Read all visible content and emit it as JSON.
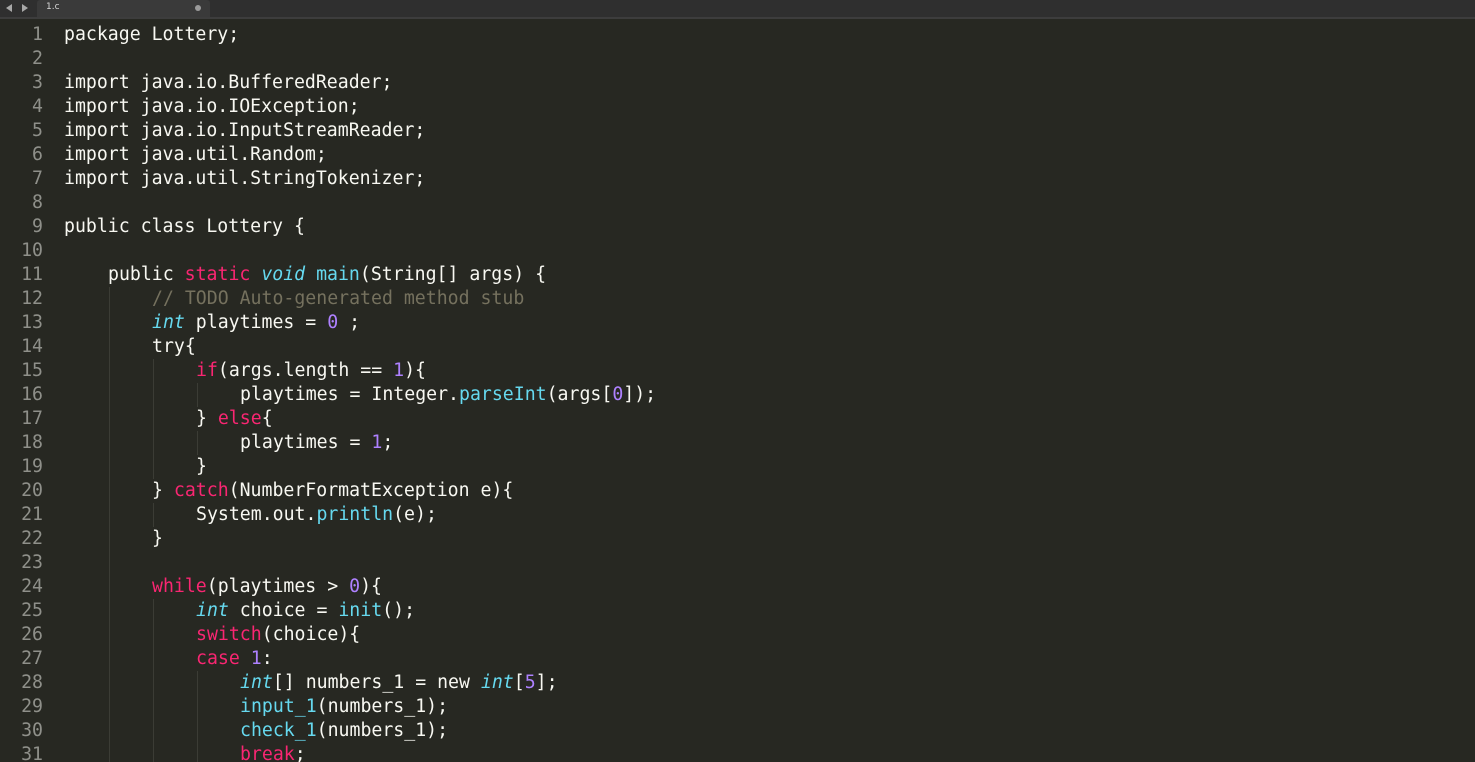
{
  "tab": {
    "title": "1.c"
  },
  "editor": {
    "lines": [
      {
        "number": "1",
        "indent": 0,
        "tokens": [
          {
            "t": "package Lottery;",
            "c": ""
          }
        ]
      },
      {
        "number": "2",
        "indent": 0,
        "tokens": []
      },
      {
        "number": "3",
        "indent": 0,
        "tokens": [
          {
            "t": "import java.io.BufferedReader;",
            "c": ""
          }
        ]
      },
      {
        "number": "4",
        "indent": 0,
        "tokens": [
          {
            "t": "import java.io.IOException;",
            "c": ""
          }
        ]
      },
      {
        "number": "5",
        "indent": 0,
        "tokens": [
          {
            "t": "import java.io.InputStreamReader;",
            "c": ""
          }
        ]
      },
      {
        "number": "6",
        "indent": 0,
        "tokens": [
          {
            "t": "import java.util.Random;",
            "c": ""
          }
        ]
      },
      {
        "number": "7",
        "indent": 0,
        "tokens": [
          {
            "t": "import java.util.StringTokenizer;",
            "c": ""
          }
        ]
      },
      {
        "number": "8",
        "indent": 0,
        "tokens": []
      },
      {
        "number": "9",
        "indent": 0,
        "tokens": [
          {
            "t": "public class Lottery {",
            "c": ""
          }
        ]
      },
      {
        "number": "10",
        "indent": 1,
        "tokens": []
      },
      {
        "number": "11",
        "indent": 1,
        "tokens": [
          {
            "t": "public ",
            "c": ""
          },
          {
            "t": "static",
            "c": "kw"
          },
          {
            "t": " ",
            "c": ""
          },
          {
            "t": "void",
            "c": "type"
          },
          {
            "t": " ",
            "c": ""
          },
          {
            "t": "main",
            "c": "fn"
          },
          {
            "t": "(String[] args) {",
            "c": ""
          }
        ]
      },
      {
        "number": "12",
        "indent": 2,
        "tokens": [
          {
            "t": "// TODO Auto-generated method stub",
            "c": "cm"
          }
        ]
      },
      {
        "number": "13",
        "indent": 2,
        "tokens": [
          {
            "t": "int",
            "c": "type"
          },
          {
            "t": " playtimes = ",
            "c": ""
          },
          {
            "t": "0",
            "c": "num"
          },
          {
            "t": " ;",
            "c": ""
          }
        ]
      },
      {
        "number": "14",
        "indent": 2,
        "tokens": [
          {
            "t": "try{",
            "c": ""
          }
        ]
      },
      {
        "number": "15",
        "indent": 3,
        "tokens": [
          {
            "t": "if",
            "c": "kw"
          },
          {
            "t": "(args.length == ",
            "c": ""
          },
          {
            "t": "1",
            "c": "num"
          },
          {
            "t": "){",
            "c": ""
          }
        ]
      },
      {
        "number": "16",
        "indent": 4,
        "tokens": [
          {
            "t": "playtimes = Integer.",
            "c": ""
          },
          {
            "t": "parseInt",
            "c": "fn"
          },
          {
            "t": "(args[",
            "c": ""
          },
          {
            "t": "0",
            "c": "num"
          },
          {
            "t": "]);",
            "c": ""
          }
        ]
      },
      {
        "number": "17",
        "indent": 3,
        "tokens": [
          {
            "t": "} ",
            "c": ""
          },
          {
            "t": "else",
            "c": "kw"
          },
          {
            "t": "{",
            "c": ""
          }
        ]
      },
      {
        "number": "18",
        "indent": 4,
        "tokens": [
          {
            "t": "playtimes = ",
            "c": ""
          },
          {
            "t": "1",
            "c": "num"
          },
          {
            "t": ";",
            "c": ""
          }
        ]
      },
      {
        "number": "19",
        "indent": 3,
        "tokens": [
          {
            "t": "}",
            "c": ""
          }
        ]
      },
      {
        "number": "20",
        "indent": 2,
        "tokens": [
          {
            "t": "} ",
            "c": ""
          },
          {
            "t": "catch",
            "c": "kw"
          },
          {
            "t": "(NumberFormatException e){",
            "c": ""
          }
        ]
      },
      {
        "number": "21",
        "indent": 3,
        "tokens": [
          {
            "t": "System.out.",
            "c": ""
          },
          {
            "t": "println",
            "c": "fn"
          },
          {
            "t": "(e);",
            "c": ""
          }
        ]
      },
      {
        "number": "22",
        "indent": 2,
        "tokens": [
          {
            "t": "}",
            "c": ""
          }
        ]
      },
      {
        "number": "23",
        "indent": 2,
        "tokens": []
      },
      {
        "number": "24",
        "indent": 2,
        "tokens": [
          {
            "t": "while",
            "c": "kw"
          },
          {
            "t": "(playtimes > ",
            "c": ""
          },
          {
            "t": "0",
            "c": "num"
          },
          {
            "t": "){",
            "c": ""
          }
        ]
      },
      {
        "number": "25",
        "indent": 3,
        "tokens": [
          {
            "t": "int",
            "c": "type"
          },
          {
            "t": " choice = ",
            "c": ""
          },
          {
            "t": "init",
            "c": "fn"
          },
          {
            "t": "();",
            "c": ""
          }
        ]
      },
      {
        "number": "26",
        "indent": 3,
        "tokens": [
          {
            "t": "switch",
            "c": "kw"
          },
          {
            "t": "(choice){",
            "c": ""
          }
        ]
      },
      {
        "number": "27",
        "indent": 3,
        "tokens": [
          {
            "t": "case",
            "c": "kw"
          },
          {
            "t": " ",
            "c": ""
          },
          {
            "t": "1",
            "c": "num"
          },
          {
            "t": ":",
            "c": ""
          }
        ]
      },
      {
        "number": "28",
        "indent": 4,
        "tokens": [
          {
            "t": "int",
            "c": "type"
          },
          {
            "t": "[] numbers_1 = new ",
            "c": ""
          },
          {
            "t": "int",
            "c": "type"
          },
          {
            "t": "[",
            "c": ""
          },
          {
            "t": "5",
            "c": "num"
          },
          {
            "t": "];",
            "c": ""
          }
        ]
      },
      {
        "number": "29",
        "indent": 4,
        "tokens": [
          {
            "t": "input_1",
            "c": "fn"
          },
          {
            "t": "(numbers_1);",
            "c": ""
          }
        ]
      },
      {
        "number": "30",
        "indent": 4,
        "tokens": [
          {
            "t": "check_1",
            "c": "fn"
          },
          {
            "t": "(numbers_1);",
            "c": ""
          }
        ]
      },
      {
        "number": "31",
        "indent": 4,
        "tokens": [
          {
            "t": "break",
            "c": "kw"
          },
          {
            "t": ";",
            "c": ""
          }
        ]
      }
    ]
  },
  "colors": {
    "background": "#272822",
    "keyword": "#f92672",
    "type": "#66d9ef",
    "function": "#66d9ef",
    "number": "#ae81ff",
    "comment": "#75715e",
    "text": "#f8f8f2",
    "gutter": "#8f908a"
  }
}
